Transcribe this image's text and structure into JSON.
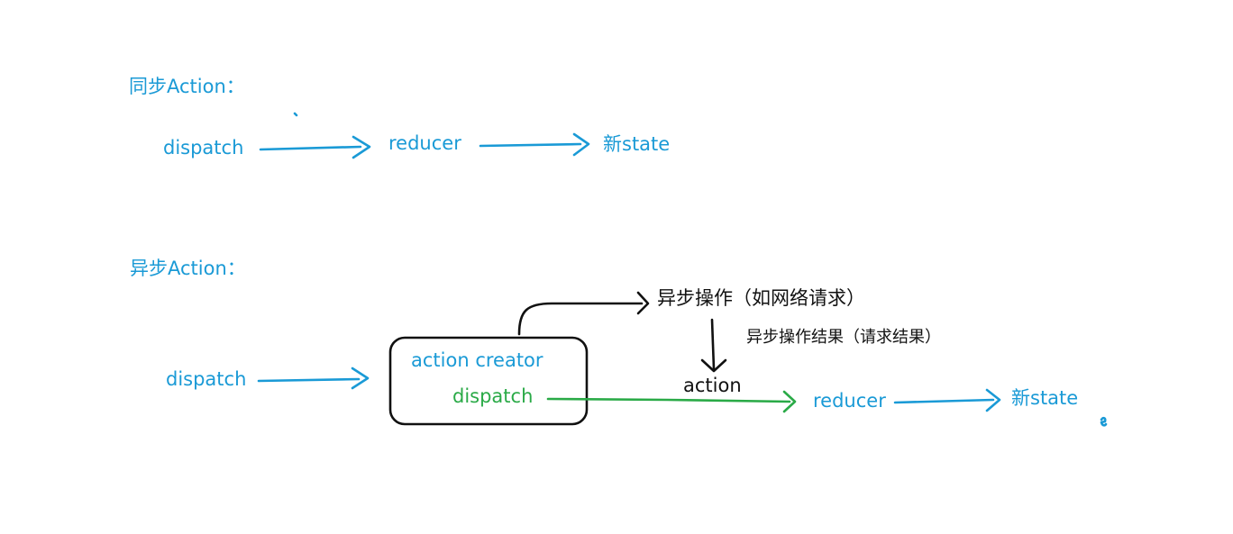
{
  "colors": {
    "blue": "#1a9ad6",
    "green": "#2aaa47",
    "black": "#111111"
  },
  "sync": {
    "title": "同步Action：",
    "dispatch": "dispatch",
    "reducer": "reducer",
    "new_state": "新state"
  },
  "async": {
    "title": "异步Action：",
    "dispatch": "dispatch",
    "action_creator": "action creator",
    "inner_dispatch": "dispatch",
    "async_op": "异步操作（如网络请求）",
    "async_result": "异步操作结果（请求结果）",
    "action": "action",
    "reducer": "reducer",
    "new_state": "新state"
  }
}
